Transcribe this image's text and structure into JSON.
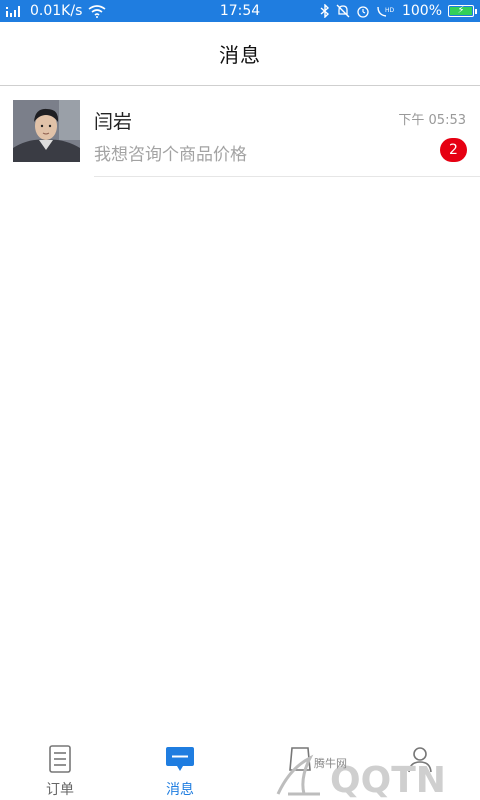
{
  "status_bar": {
    "network_speed": "0.01K/s",
    "time": "17:54",
    "battery_percent": "100%",
    "colors": {
      "background": "#1f7de0",
      "battery_fill": "#33d05a"
    }
  },
  "header": {
    "title": "消息"
  },
  "conversations": [
    {
      "name": "闫岩",
      "time": "下午 05:53",
      "preview": "我想咨询个商品价格",
      "unread": "2"
    }
  ],
  "tabbar": {
    "tabs": [
      {
        "label": "订单",
        "icon": "order-list-icon",
        "active": false
      },
      {
        "label": "消息",
        "icon": "message-bubble-icon",
        "active": true
      },
      {
        "label": "",
        "icon": "goods-icon",
        "active": false
      },
      {
        "label": "",
        "icon": "profile-icon",
        "active": false
      }
    ],
    "colors": {
      "active": "#1f7de0",
      "inactive": "#666666"
    }
  },
  "watermark": {
    "brand": "QQTN",
    "site_text": "腾牛网"
  }
}
